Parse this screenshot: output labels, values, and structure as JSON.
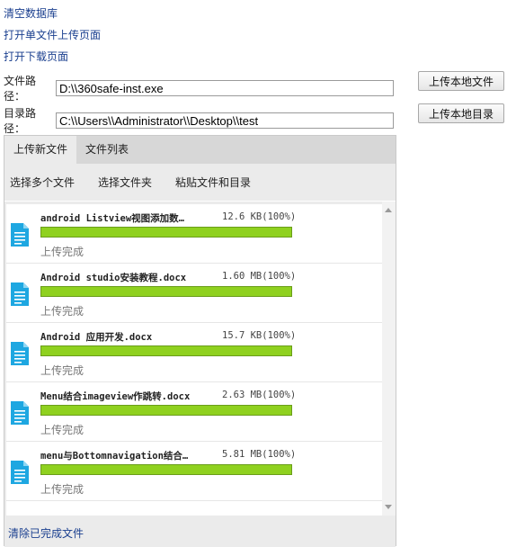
{
  "links": {
    "clear_db": "清空数据库",
    "open_single_upload": "打开单文件上传页面",
    "open_download": "打开下载页面"
  },
  "file_path": {
    "label": "文件路径：",
    "value": "D:\\\\360safe-inst.exe",
    "button": "上传本地文件"
  },
  "dir_path": {
    "label": "目录路径：",
    "value": "C:\\\\Users\\\\Administrator\\\\Desktop\\\\test",
    "button": "上传本地目录"
  },
  "tabs": [
    {
      "label": "上传新文件",
      "active": true
    },
    {
      "label": "文件列表",
      "active": false
    }
  ],
  "toolbar": {
    "select_multiple": "选择多个文件",
    "select_folder": "选择文件夹",
    "paste": "粘贴文件和目录"
  },
  "files": [
    {
      "name": "android Listview视图添加数…",
      "size": "12.6 KB(100%)",
      "progress": 100,
      "status": "上传完成"
    },
    {
      "name": "Android studio安装教程.docx",
      "size": "1.60 MB(100%)",
      "progress": 100,
      "status": "上传完成"
    },
    {
      "name": "Android 应用开发.docx",
      "size": "15.7 KB(100%)",
      "progress": 100,
      "status": "上传完成"
    },
    {
      "name": "Menu结合imageview作跳转.docx",
      "size": "2.63 MB(100%)",
      "progress": 100,
      "status": "上传完成"
    },
    {
      "name": "menu与Bottomnavigation结合…",
      "size": "5.81 MB(100%)",
      "progress": 100,
      "status": "上传完成"
    }
  ],
  "footer": {
    "clear_completed": "清除已完成文件"
  },
  "colors": {
    "accent_link": "#1a3f8f",
    "progress_fill": "#8fd11f",
    "file_icon": "#1ea7e1"
  }
}
